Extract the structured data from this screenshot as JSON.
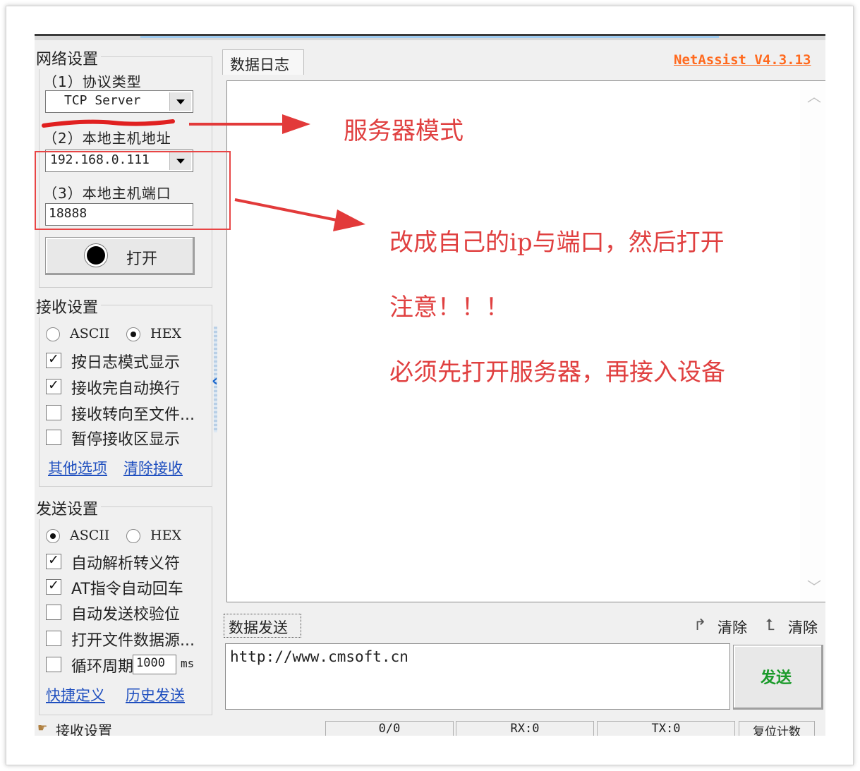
{
  "network": {
    "title": "网络设置",
    "protocol_label": "（1）协议类型",
    "protocol_value": "TCP Server",
    "host_label": "（2）本地主机地址",
    "host_value": "192.168.0.111",
    "port_label": "（3）本地主机端口",
    "port_value": "18888",
    "open_label": "打开"
  },
  "receive": {
    "title": "接收设置",
    "ascii_label": "ASCII",
    "hex_label": "HEX",
    "selected": "HEX",
    "options": [
      {
        "label": "按日志模式显示",
        "checked": true
      },
      {
        "label": "接收完自动换行",
        "checked": true
      },
      {
        "label": "接收转向至文件...",
        "checked": false
      },
      {
        "label": "暂停接收区显示",
        "checked": false
      }
    ],
    "link_other": "其他选项",
    "link_clear": "清除接收"
  },
  "send": {
    "title": "发送设置",
    "ascii_label": "ASCII",
    "hex_label": "HEX",
    "selected": "ASCII",
    "options": [
      {
        "label": "自动解析转义符",
        "checked": true
      },
      {
        "label": "AT指令自动回车",
        "checked": true
      },
      {
        "label": "自动发送校验位",
        "checked": false
      },
      {
        "label": "打开文件数据源...",
        "checked": false
      },
      {
        "label": "循环周期",
        "checked": false
      }
    ],
    "period_value": "1000",
    "period_unit": "ms",
    "link_shortcut": "快捷定义",
    "link_history": "历史发送"
  },
  "log_tab": "数据日志",
  "brand": "NetAssist V4.3.13",
  "annotations": {
    "server_mode": "服务器模式",
    "change_ip": "改成自己的ip与端口，然后打开",
    "note": "注意！！！",
    "must_open": "必须先打开服务器，再接入设备"
  },
  "send_area": {
    "tab": "数据发送",
    "clear1": "清除",
    "clear2": "清除",
    "input_value": "http://www.cmsoft.cn",
    "send_label": "发送"
  },
  "statusbar": {
    "left": "接收设置",
    "count": "0/0",
    "rx": "RX:0",
    "tx": "TX:0",
    "reset": "复位计数"
  },
  "colors": {
    "annotation_red": "#e04040",
    "brand_orange": "#ff6a1f",
    "send_green": "#1a9a2a",
    "link_blue": "#1f4fbf"
  }
}
